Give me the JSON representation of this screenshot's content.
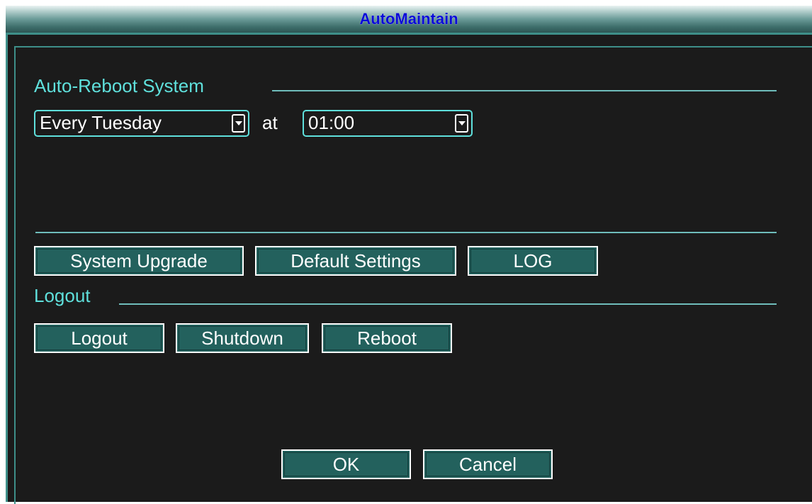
{
  "window": {
    "title": "AutoMaintain"
  },
  "auto_reboot": {
    "section_label": "Auto-Reboot System",
    "day_value": "Every Tuesday",
    "at_label": "at",
    "time_value": "01:00"
  },
  "maintenance_buttons": {
    "system_upgrade": "System Upgrade",
    "default_settings": "Default Settings",
    "log": "LOG"
  },
  "logout_section": {
    "section_label": "Logout",
    "logout": "Logout",
    "shutdown": "Shutdown",
    "reboot": "Reboot"
  },
  "footer": {
    "ok": "OK",
    "cancel": "Cancel"
  },
  "colors": {
    "accent_cyan": "#5fe0dc",
    "button_fill": "#23615d",
    "panel_bg": "#1b1b1b",
    "title_text": "#0a0ad8"
  }
}
